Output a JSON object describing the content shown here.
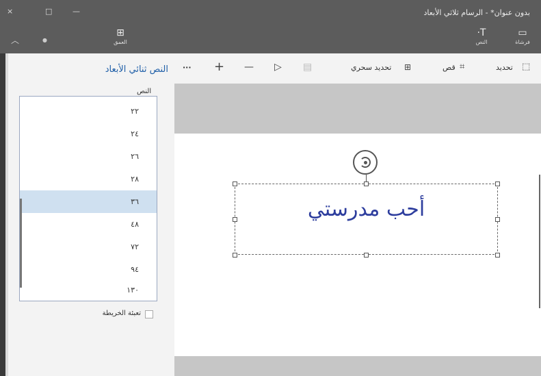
{
  "window": {
    "title": "بدون عنوان* - الرسام ثلاثي الأبعاد",
    "close_glyph": "×",
    "maximize_glyph": "□",
    "minimize_glyph": "—"
  },
  "ribbon": {
    "brushes_label": "فرشاة",
    "text_label": "النص",
    "third_label": "العمق",
    "brushes_icon": "rectangle-icon",
    "text_icon": "text-t-icon"
  },
  "toolbar": {
    "select": "تحديد",
    "crop": "قص",
    "magic_select": "تحديد سحري",
    "more": "···",
    "plus": "+",
    "minus": "—"
  },
  "panel": {
    "title": "النص ثنائي الأبعاد",
    "font_label": "النص",
    "font_sizes": [
      "٢٢",
      "٢٤",
      "٢٦",
      "٢٨",
      "٣٦",
      "٤٨",
      "٧٢",
      "٩٤",
      "١٣٠"
    ],
    "selected_index": 4,
    "fill_label": "تعبئة الخريطة"
  },
  "canvas": {
    "text": "أحب مدرستي",
    "text_color": "#2e3e9e"
  }
}
